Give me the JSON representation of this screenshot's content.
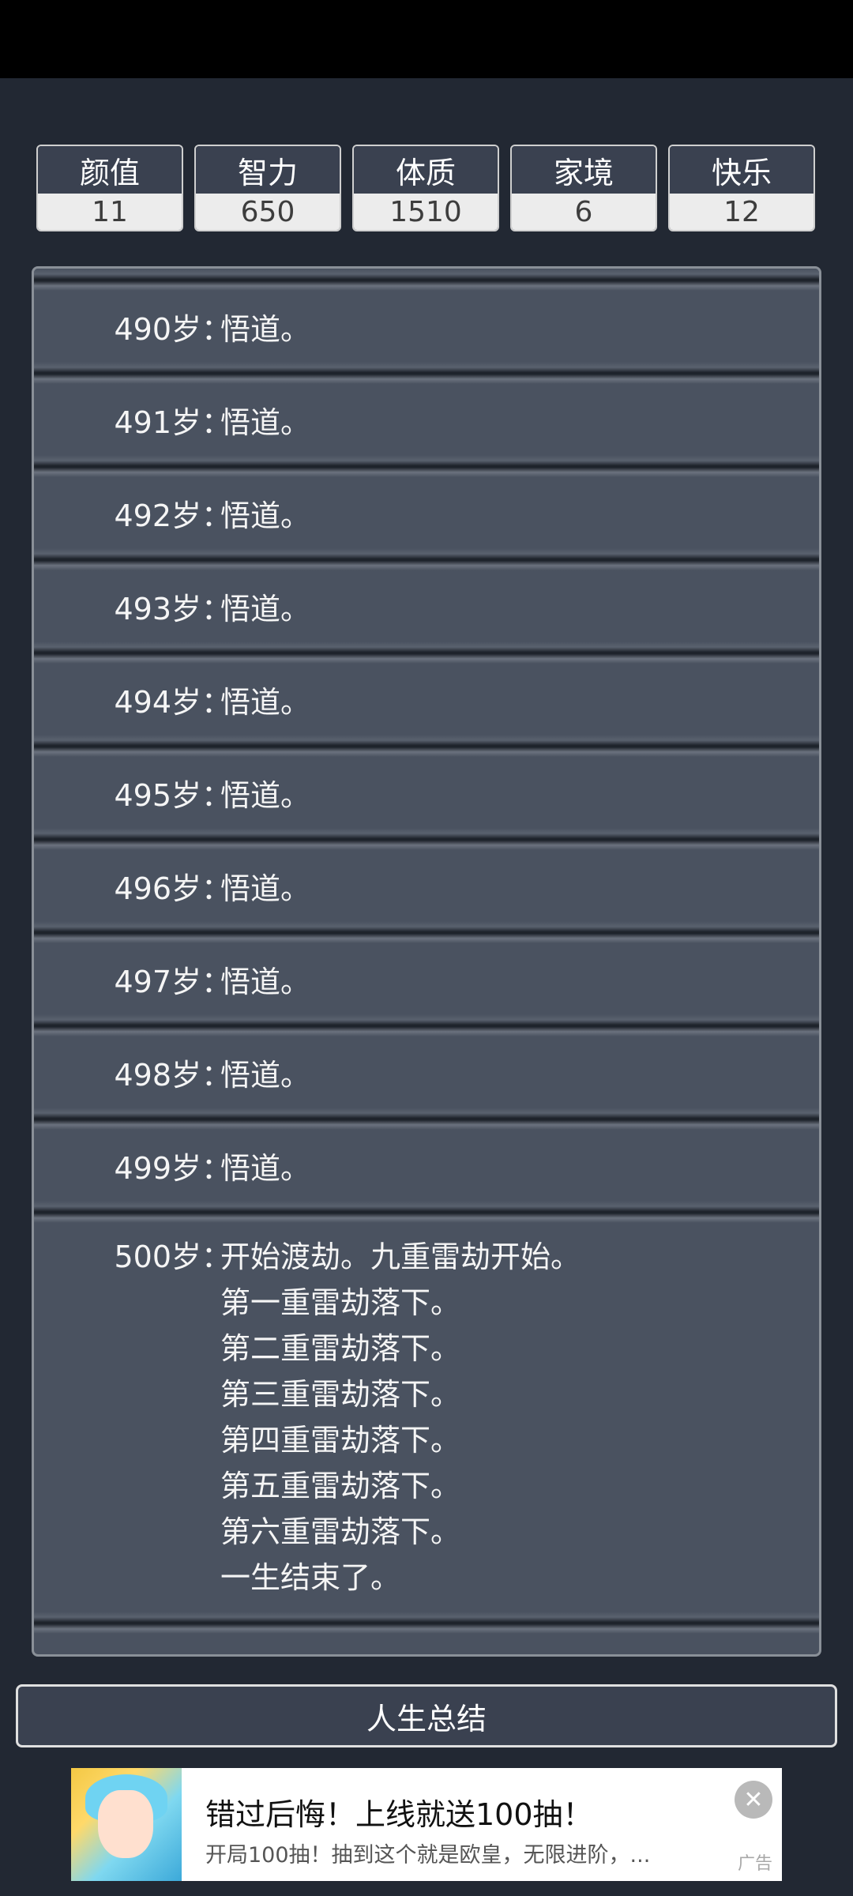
{
  "stats": [
    {
      "label": "颜值",
      "value": "11"
    },
    {
      "label": "智力",
      "value": "650"
    },
    {
      "label": "体质",
      "value": "1510"
    },
    {
      "label": "家境",
      "value": "6"
    },
    {
      "label": "快乐",
      "value": "12"
    }
  ],
  "log": {
    "colon": "：",
    "entries": [
      {
        "age": "490岁",
        "text": "悟道。"
      },
      {
        "age": "491岁",
        "text": "悟道。"
      },
      {
        "age": "492岁",
        "text": "悟道。"
      },
      {
        "age": "493岁",
        "text": "悟道。"
      },
      {
        "age": "494岁",
        "text": "悟道。"
      },
      {
        "age": "495岁",
        "text": "悟道。"
      },
      {
        "age": "496岁",
        "text": "悟道。"
      },
      {
        "age": "497岁",
        "text": "悟道。"
      },
      {
        "age": "498岁",
        "text": "悟道。"
      },
      {
        "age": "499岁",
        "text": "悟道。"
      }
    ],
    "final": {
      "age": "500岁",
      "lines": [
        "开始渡劫。九重雷劫开始。",
        "第一重雷劫落下。",
        "第二重雷劫落下。",
        "第三重雷劫落下。",
        "第四重雷劫落下。",
        "第五重雷劫落下。",
        "第六重雷劫落下。",
        "一生结束了。"
      ]
    }
  },
  "summary_button": "人生总结",
  "ad": {
    "title": "错过后悔！上线就送100抽！",
    "description": "开局100抽！抽到这个就是欧皇，无限进阶，...",
    "tag": "广告",
    "close_icon": "close-icon"
  }
}
